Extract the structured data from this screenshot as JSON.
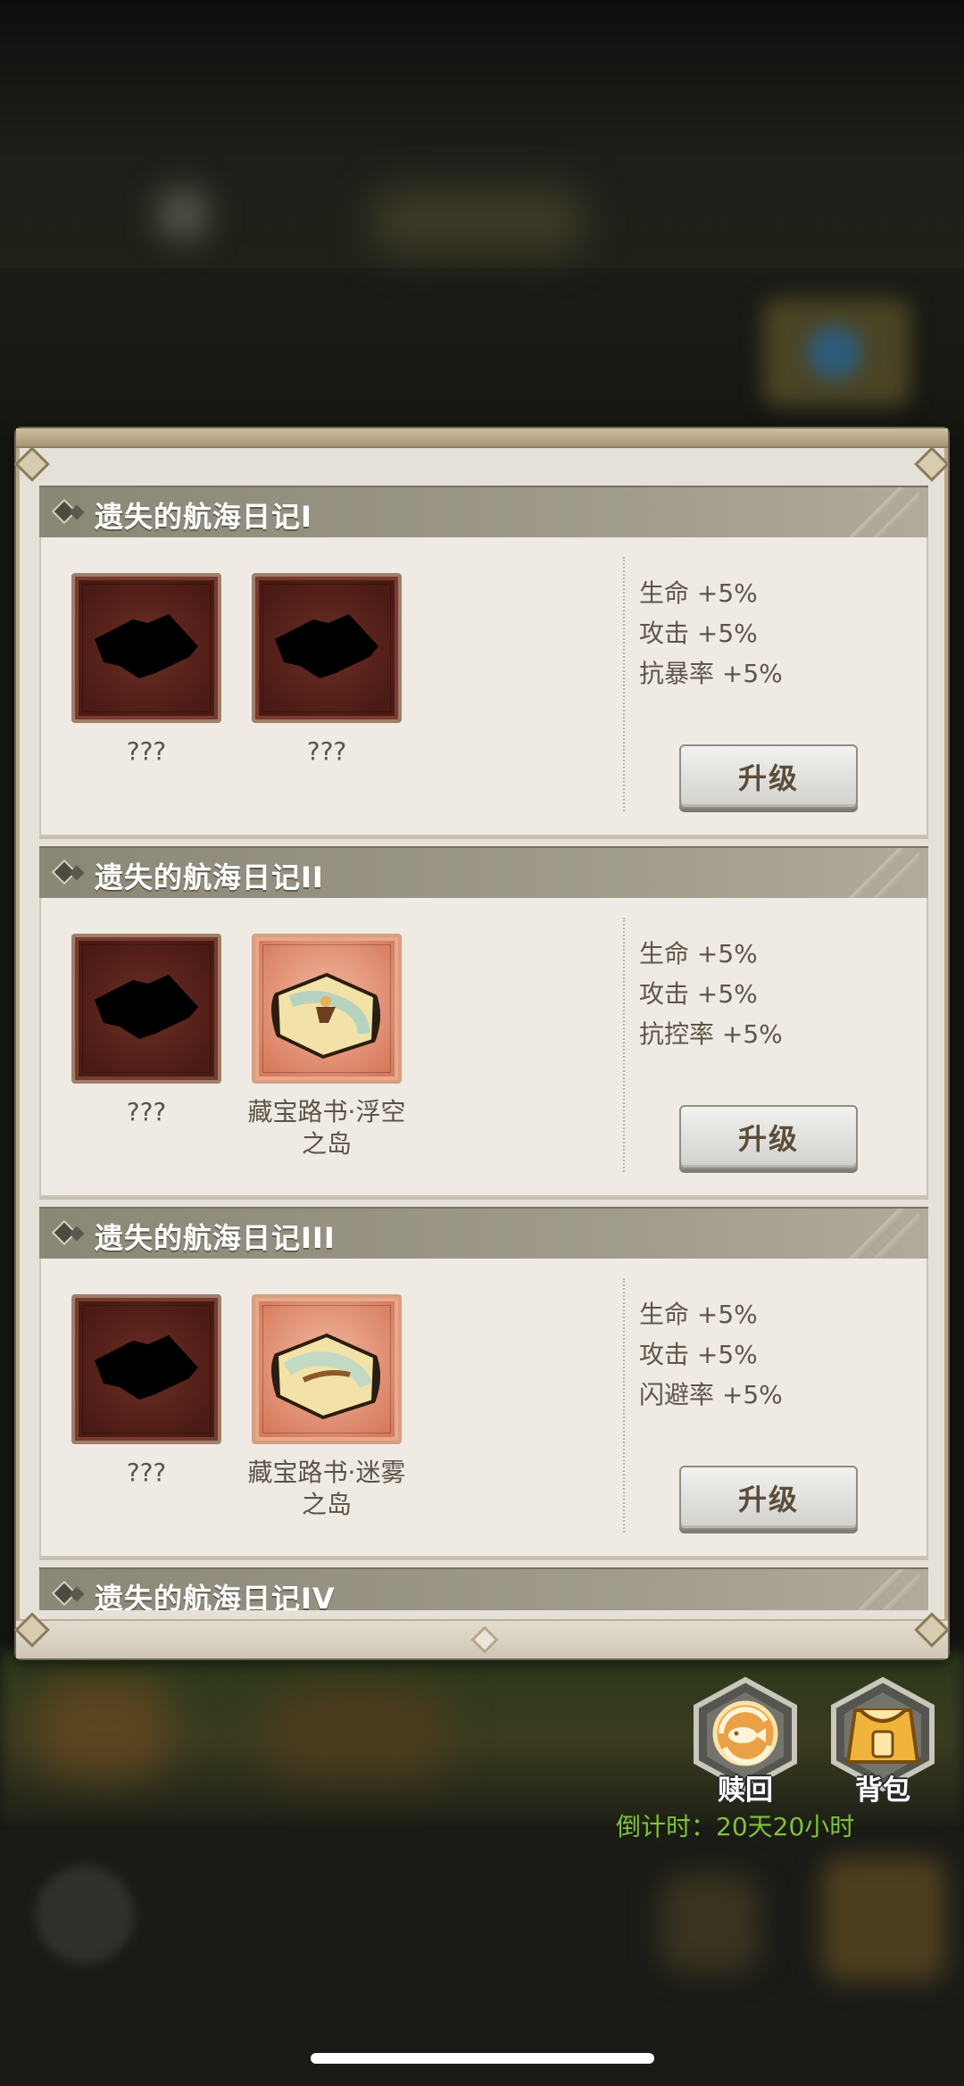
{
  "sections": [
    {
      "title": "遗失的航海日记I",
      "items": [
        {
          "label": "???",
          "state": "locked",
          "icon": "scroll-silhouette-icon"
        },
        {
          "label": "???",
          "state": "locked",
          "icon": "scroll-silhouette-icon"
        }
      ],
      "stats": [
        "生命 +5%",
        "攻击 +5%",
        "抗暴率 +5%"
      ],
      "button": "升级"
    },
    {
      "title": "遗失的航海日记II",
      "items": [
        {
          "label": "???",
          "state": "locked",
          "icon": "scroll-silhouette-icon"
        },
        {
          "label": "藏宝路书·浮空\n之岛",
          "state": "unlocked",
          "icon": "treasure-map-icon"
        }
      ],
      "stats": [
        "生命 +5%",
        "攻击 +5%",
        "抗控率 +5%"
      ],
      "button": "升级"
    },
    {
      "title": "遗失的航海日记III",
      "items": [
        {
          "label": "???",
          "state": "locked",
          "icon": "scroll-silhouette-icon"
        },
        {
          "label": "藏宝路书·迷雾\n之岛",
          "state": "unlocked",
          "icon": "treasure-map-icon"
        }
      ],
      "stats": [
        "生命 +5%",
        "攻击 +5%",
        "闪避率 +5%"
      ],
      "button": "升级"
    },
    {
      "title": "遗失的航海日记IV"
    }
  ],
  "side_buttons": [
    {
      "label": "赎回",
      "icon": "fish-redeem-icon"
    },
    {
      "label": "背包",
      "icon": "backpack-icon"
    }
  ],
  "countdown": "倒计时：20天20小时",
  "colors": {
    "panel_bg": "#e6e1d8",
    "header_bg": "#8b8777",
    "locked_slot": "#4a1a14",
    "unlocked_slot": "#d77a5d",
    "countdown": "#7ec23b"
  }
}
